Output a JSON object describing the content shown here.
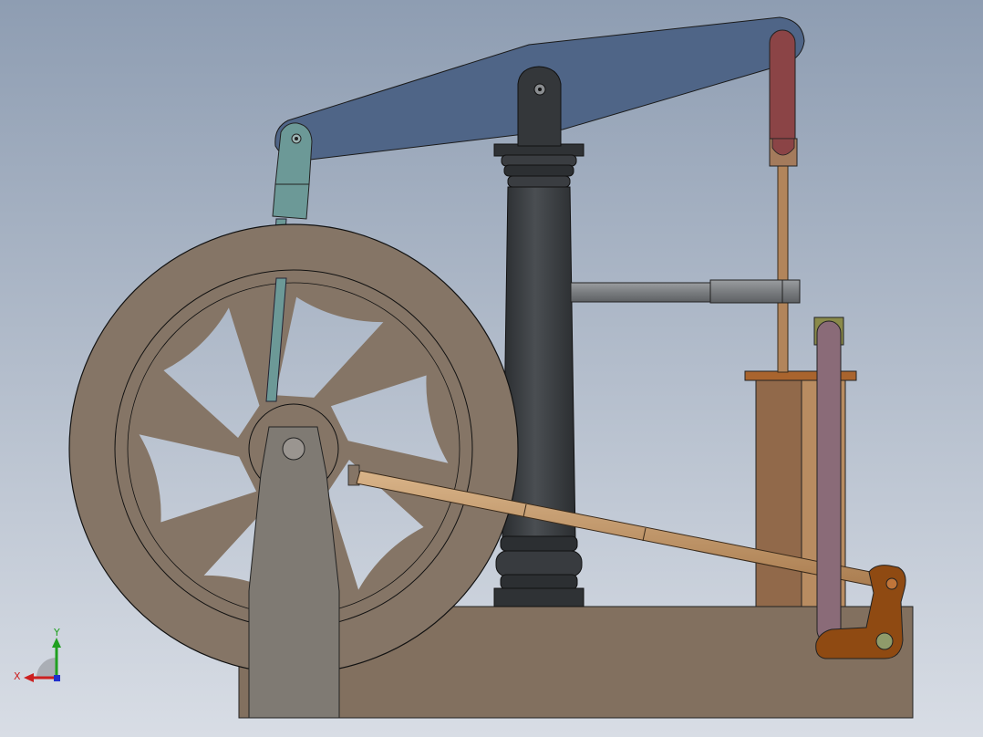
{
  "viewport": {
    "background_top": "#8e9db2",
    "background_bottom": "#d8dde5"
  },
  "model": {
    "colors": {
      "beam": "#4f6587",
      "column": "#373b3f",
      "flywheel": "#857566",
      "flywheel_support": "#7f7a73",
      "base": "#82705f",
      "teal_link": "#6c9997",
      "red_rod": "#8b4446",
      "copper_rod": "#b2855b",
      "cylinder_dark": "#91694a",
      "cylinder_light": "#b88c61",
      "cylinder_flange": "#a9642e",
      "pink_rod": "#8a6b78",
      "crank_orange": "#8f4a12",
      "connecting_rod": "#c9a071",
      "gray_arm": "#7a7d80"
    }
  },
  "triad": {
    "x_label": "X",
    "y_label": "Y",
    "x_color": "#cc2020",
    "y_color": "#20a020",
    "z_color": "#2030cc"
  }
}
